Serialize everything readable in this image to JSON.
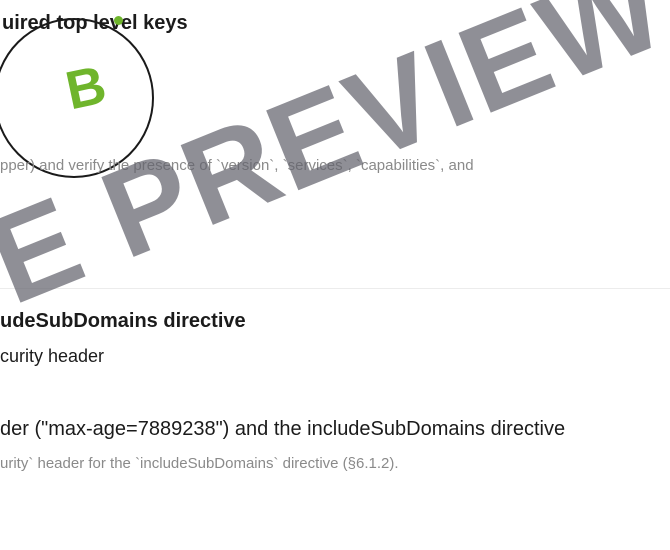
{
  "finding_one": {
    "title": "uired top level keys",
    "description": "pper) and verify the presence of `version`, `services`, `capabilities`, and"
  },
  "grade_badge": {
    "letter": "B",
    "accent_color": "#6fb52c"
  },
  "finding_two": {
    "title": "udeSubDomains directive",
    "subtitle": "curity header",
    "finding": "der (\"max-age=7889238\") and the includeSubDomains directive",
    "description": "urity` header for the `includeSubDomains` directive (§6.1.2)."
  },
  "watermark": {
    "text": "E PREVIEW"
  }
}
